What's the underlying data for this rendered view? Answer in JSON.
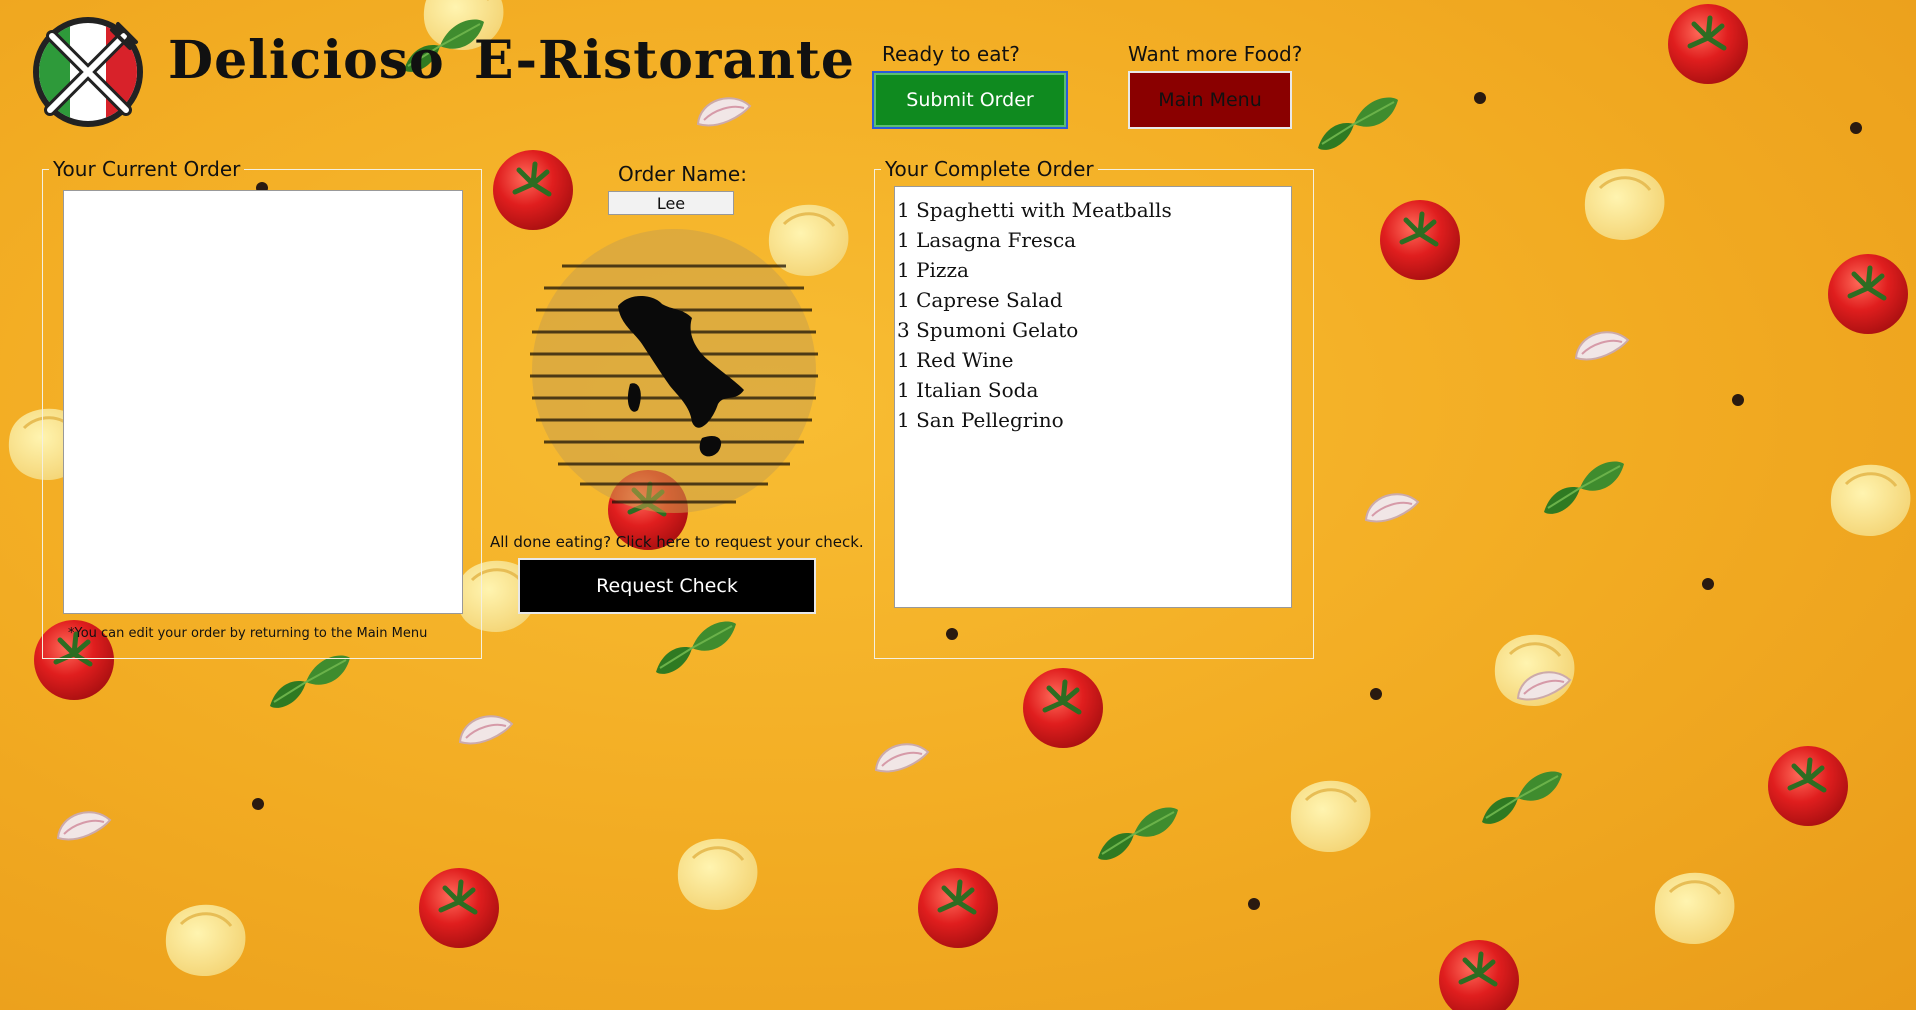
{
  "app": {
    "title": "Delicioso  E-Ristorante"
  },
  "submit": {
    "prompt": "Ready to eat?",
    "button_label": "Submit Order",
    "color": "#0f8a1f"
  },
  "menu": {
    "prompt": "Want more Food?",
    "button_label": "Main Menu",
    "color": "#8a0000"
  },
  "current_order": {
    "legend": "Your Current Order",
    "items": [],
    "note": "*You can edit your order by returning to the Main Menu"
  },
  "order_name": {
    "label": "Order Name:",
    "value": "Lee"
  },
  "check": {
    "prompt": "All done eating? Click here to request your check.",
    "button_label": "Request Check"
  },
  "complete_order": {
    "legend": "Your Complete Order",
    "items": [
      "1 Spaghetti with Meatballs",
      "1 Lasagna Fresca",
      "1 Pizza",
      "1 Caprese Salad",
      "3 Spumoni Gelato",
      "1 Red Wine",
      "1 Italian Soda",
      "1 San Pellegrino"
    ]
  },
  "icons": {
    "logo": "fork-knife-logo-icon",
    "map": "italy-food-word-map-icon"
  },
  "colors": {
    "background": "#f2ab22",
    "tomato": "#d81e1e",
    "basil": "#2f7a2a"
  }
}
